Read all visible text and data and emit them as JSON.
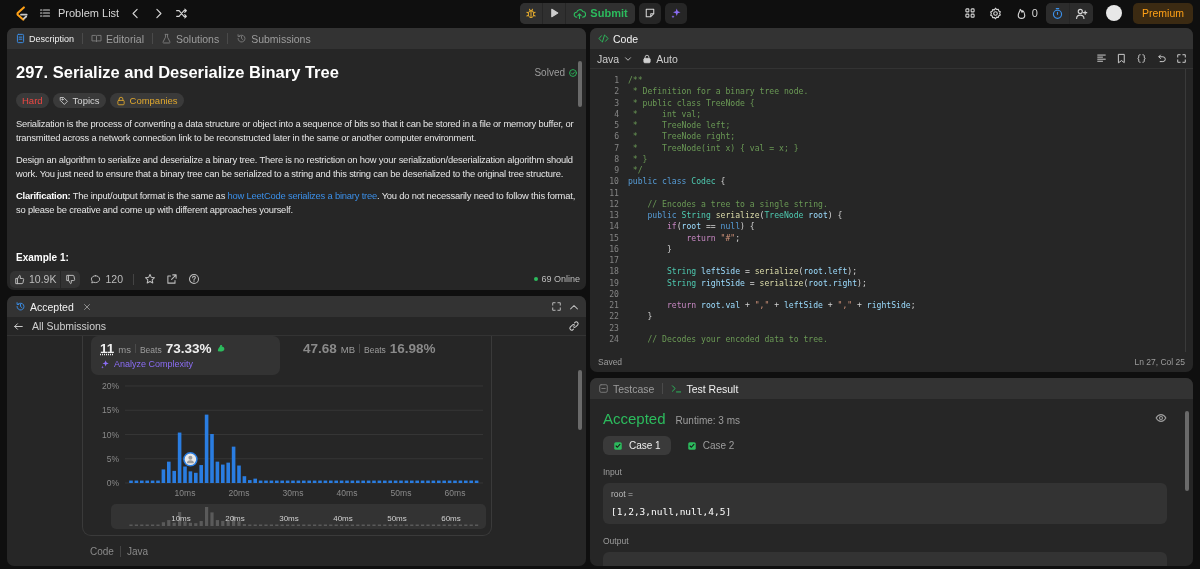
{
  "top_bar": {
    "problem_list": "Problem List",
    "submit": "Submit",
    "streak": "0",
    "premium": "Premium"
  },
  "description": {
    "tabs": [
      {
        "kind": "description",
        "label": "Description",
        "selected": true
      },
      {
        "kind": "editorial",
        "label": "Editorial",
        "selected": false
      },
      {
        "kind": "solutions",
        "label": "Solutions",
        "selected": false
      },
      {
        "kind": "submissions",
        "label": "Submissions",
        "selected": false
      }
    ],
    "title": "297. Serialize and Deserialize Binary Tree",
    "status": "Solved",
    "tags": [
      {
        "kind": "difficulty",
        "label": "Hard"
      },
      {
        "kind": "topics",
        "label": "Topics"
      },
      {
        "kind": "companies",
        "label": "Companies"
      }
    ],
    "paragraphs": [
      {
        "text": "Serialization is the process of converting a data structure or object into a sequence of bits so that it can be stored in a file or memory buffer, or transmitted across a network connection link to be reconstructed later in the same or another computer environment."
      },
      {
        "text": "Design an algorithm to serialize and deserialize a binary tree. There is no restriction on how your serialization/deserialization algorithm should work. You just need to ensure that a binary tree can be serialized to a string and this string can be deserialized to the original tree structure."
      },
      {
        "text": "**Clarification:** The input/output format is the same as ",
        "link": "how LeetCode serializes a binary tree",
        "after": ". You do not necessarily need to follow this format, so please be creative and come up with different approaches yourself."
      }
    ],
    "example_heading": "Example 1:",
    "likes": "10.9K",
    "comments": "120",
    "online": "69 Online"
  },
  "submission": {
    "tab": "Accepted",
    "back": "All Submissions",
    "metrics": [
      {
        "value": "11",
        "unit": "ms",
        "beats_label": "Beats",
        "beats": "73.33%",
        "selected": true
      },
      {
        "value": "47.68",
        "unit": "MB",
        "beats_label": "Beats",
        "beats": "16.98%",
        "selected": false
      }
    ],
    "analyze": "Analyze Complexity",
    "chart_data": {
      "type": "bar",
      "x": [
        0,
        1,
        2,
        3,
        4,
        5,
        6,
        7,
        8,
        9,
        10,
        11,
        12,
        13,
        14,
        15,
        16,
        17,
        18,
        19,
        20,
        21,
        22,
        23,
        24,
        25,
        26,
        27,
        28,
        29,
        30,
        31,
        32,
        33,
        34,
        35,
        36,
        37,
        38,
        39,
        40,
        41,
        42,
        43,
        44,
        45,
        46,
        47,
        48,
        49,
        50,
        51,
        52,
        53,
        54,
        55,
        56,
        57,
        58,
        59,
        60,
        61,
        62,
        63,
        64
      ],
      "values": [
        0.5,
        0.5,
        0.5,
        0.5,
        0.5,
        0.5,
        2.8,
        4.4,
        2.5,
        10.4,
        3.4,
        2.4,
        2.1,
        3.7,
        14.1,
        10.1,
        4.4,
        3.8,
        4.2,
        7.5,
        3.6,
        1.4,
        0.6,
        0.9,
        0.5,
        0.5,
        0.5,
        0.5,
        0.5,
        0.5,
        0.5,
        0.5,
        0.5,
        0.5,
        0.5,
        0.5,
        0.5,
        0.5,
        0.5,
        0.5,
        0.5,
        0.5,
        0.5,
        0.5,
        0.5,
        0.5,
        0.5,
        0.5,
        0.5,
        0.5,
        0.5,
        0.5,
        0.5,
        0.5,
        0.5,
        0.5,
        0.5,
        0.5,
        0.5,
        0.5,
        0.5,
        0.5,
        0.5,
        0.5,
        0.5
      ],
      "xlim": [
        0,
        64
      ],
      "ylim": [
        0,
        20
      ],
      "grid": true,
      "yticks": [
        {
          "value": 0,
          "label": "0%"
        },
        {
          "value": 5,
          "label": "5%"
        },
        {
          "value": 10,
          "label": "10%"
        },
        {
          "value": 15,
          "label": "15%"
        },
        {
          "value": 20,
          "label": "20%"
        }
      ],
      "xticks": [
        {
          "value": 10,
          "label": "10ms"
        },
        {
          "value": 20,
          "label": "20ms"
        },
        {
          "value": 30,
          "label": "30ms"
        },
        {
          "value": 40,
          "label": "40ms"
        },
        {
          "value": 50,
          "label": "50ms"
        },
        {
          "value": 60,
          "label": "60ms"
        }
      ]
    },
    "overview_labels": [
      "10ms",
      "20ms",
      "30ms",
      "40ms",
      "50ms",
      "60ms"
    ],
    "code_label": "Code",
    "language": "Java"
  },
  "code": {
    "tab": "Code",
    "language": "Java",
    "mode": "Auto",
    "lines": [
      {
        "num": "1",
        "tokens": [
          {
            "kind": "comment",
            "text": "/**"
          }
        ]
      },
      {
        "num": "2",
        "tokens": [
          {
            "kind": "comment",
            "text": " * Definition for a binary tree node."
          }
        ]
      },
      {
        "num": "3",
        "tokens": [
          {
            "kind": "comment",
            "text": " * public class TreeNode {"
          }
        ]
      },
      {
        "num": "4",
        "tokens": [
          {
            "kind": "comment",
            "text": " *     int val;"
          }
        ]
      },
      {
        "num": "5",
        "tokens": [
          {
            "kind": "comment",
            "text": " *     TreeNode left;"
          }
        ]
      },
      {
        "num": "6",
        "tokens": [
          {
            "kind": "comment",
            "text": " *     TreeNode right;"
          }
        ]
      },
      {
        "num": "7",
        "tokens": [
          {
            "kind": "comment",
            "text": " *     TreeNode(int x) { val = x; }"
          }
        ]
      },
      {
        "num": "8",
        "tokens": [
          {
            "kind": "comment",
            "text": " * }"
          }
        ]
      },
      {
        "num": "9",
        "tokens": [
          {
            "kind": "comment",
            "text": " */"
          }
        ]
      },
      {
        "num": "10",
        "tokens": [
          {
            "kind": "keyword",
            "text": "public class "
          },
          {
            "kind": "type",
            "text": "Codec"
          },
          {
            "kind": "plain",
            "text": " {"
          }
        ]
      },
      {
        "num": "11"
      },
      {
        "num": "12",
        "tokens": [
          {
            "kind": "comment",
            "text": "    // Encodes a tree to a single string."
          }
        ]
      },
      {
        "num": "13",
        "tokens": [
          {
            "kind": "keyword",
            "text": "    public "
          },
          {
            "kind": "type",
            "text": "String "
          },
          {
            "kind": "func",
            "text": "serialize"
          },
          {
            "kind": "plain",
            "text": "("
          },
          {
            "kind": "type",
            "text": "TreeNode "
          },
          {
            "kind": "var",
            "text": "root"
          },
          {
            "kind": "plain",
            "text": ") {"
          }
        ]
      },
      {
        "num": "14",
        "tokens": [
          {
            "kind": "control",
            "text": "        if"
          },
          {
            "kind": "plain",
            "text": "("
          },
          {
            "kind": "var",
            "text": "root"
          },
          {
            "kind": "plain",
            "text": " == "
          },
          {
            "kind": "keyword",
            "text": "null"
          },
          {
            "kind": "plain",
            "text": ") {"
          }
        ]
      },
      {
        "num": "15",
        "tokens": [
          {
            "kind": "control",
            "text": "            return "
          },
          {
            "kind": "string",
            "text": "\"#\""
          },
          {
            "kind": "plain",
            "text": ";"
          }
        ]
      },
      {
        "num": "16",
        "tokens": [
          {
            "kind": "plain",
            "text": "        }"
          }
        ]
      },
      {
        "num": "17"
      },
      {
        "num": "18",
        "tokens": [
          {
            "kind": "type",
            "text": "        String "
          },
          {
            "kind": "var",
            "text": "leftSide"
          },
          {
            "kind": "plain",
            "text": " = "
          },
          {
            "kind": "func",
            "text": "serialize"
          },
          {
            "kind": "plain",
            "text": "("
          },
          {
            "kind": "var",
            "text": "root.left"
          },
          {
            "kind": "plain",
            "text": ");"
          }
        ]
      },
      {
        "num": "19",
        "tokens": [
          {
            "kind": "type",
            "text": "        String "
          },
          {
            "kind": "var",
            "text": "rightSide"
          },
          {
            "kind": "plain",
            "text": " = "
          },
          {
            "kind": "func",
            "text": "serialize"
          },
          {
            "kind": "plain",
            "text": "("
          },
          {
            "kind": "var",
            "text": "root.right"
          },
          {
            "kind": "plain",
            "text": ");"
          }
        ]
      },
      {
        "num": "20"
      },
      {
        "num": "21",
        "tokens": [
          {
            "kind": "control",
            "text": "        return "
          },
          {
            "kind": "var",
            "text": "root.val"
          },
          {
            "kind": "plain",
            "text": " + "
          },
          {
            "kind": "string",
            "text": "\",\""
          },
          {
            "kind": "plain",
            "text": " + "
          },
          {
            "kind": "var",
            "text": "leftSide"
          },
          {
            "kind": "plain",
            "text": " + "
          },
          {
            "kind": "string",
            "text": "\",\""
          },
          {
            "kind": "plain",
            "text": " + "
          },
          {
            "kind": "var",
            "text": "rightSide"
          },
          {
            "kind": "plain",
            "text": ";"
          }
        ]
      },
      {
        "num": "22",
        "tokens": [
          {
            "kind": "plain",
            "text": "    }"
          }
        ]
      },
      {
        "num": "23"
      },
      {
        "num": "24",
        "tokens": [
          {
            "kind": "comment",
            "text": "    // Decodes your encoded data to tree."
          }
        ]
      }
    ],
    "status": "Saved",
    "cursor": "Ln 27, Col 25"
  },
  "result": {
    "tabs": [
      {
        "kind": "testcase",
        "label": "Testcase",
        "selected": false
      },
      {
        "kind": "result",
        "label": "Test Result",
        "selected": true
      }
    ],
    "verdict": "Accepted",
    "runtime": "Runtime: 3 ms",
    "cases": [
      {
        "label": "Case 1",
        "selected": true,
        "passed": true
      },
      {
        "label": "Case 2",
        "selected": false,
        "passed": true
      }
    ],
    "input_label": "Input",
    "inputs": [
      {
        "name": "root =",
        "value": "[1,2,3,null,null,4,5]"
      }
    ],
    "output_label": "Output"
  }
}
